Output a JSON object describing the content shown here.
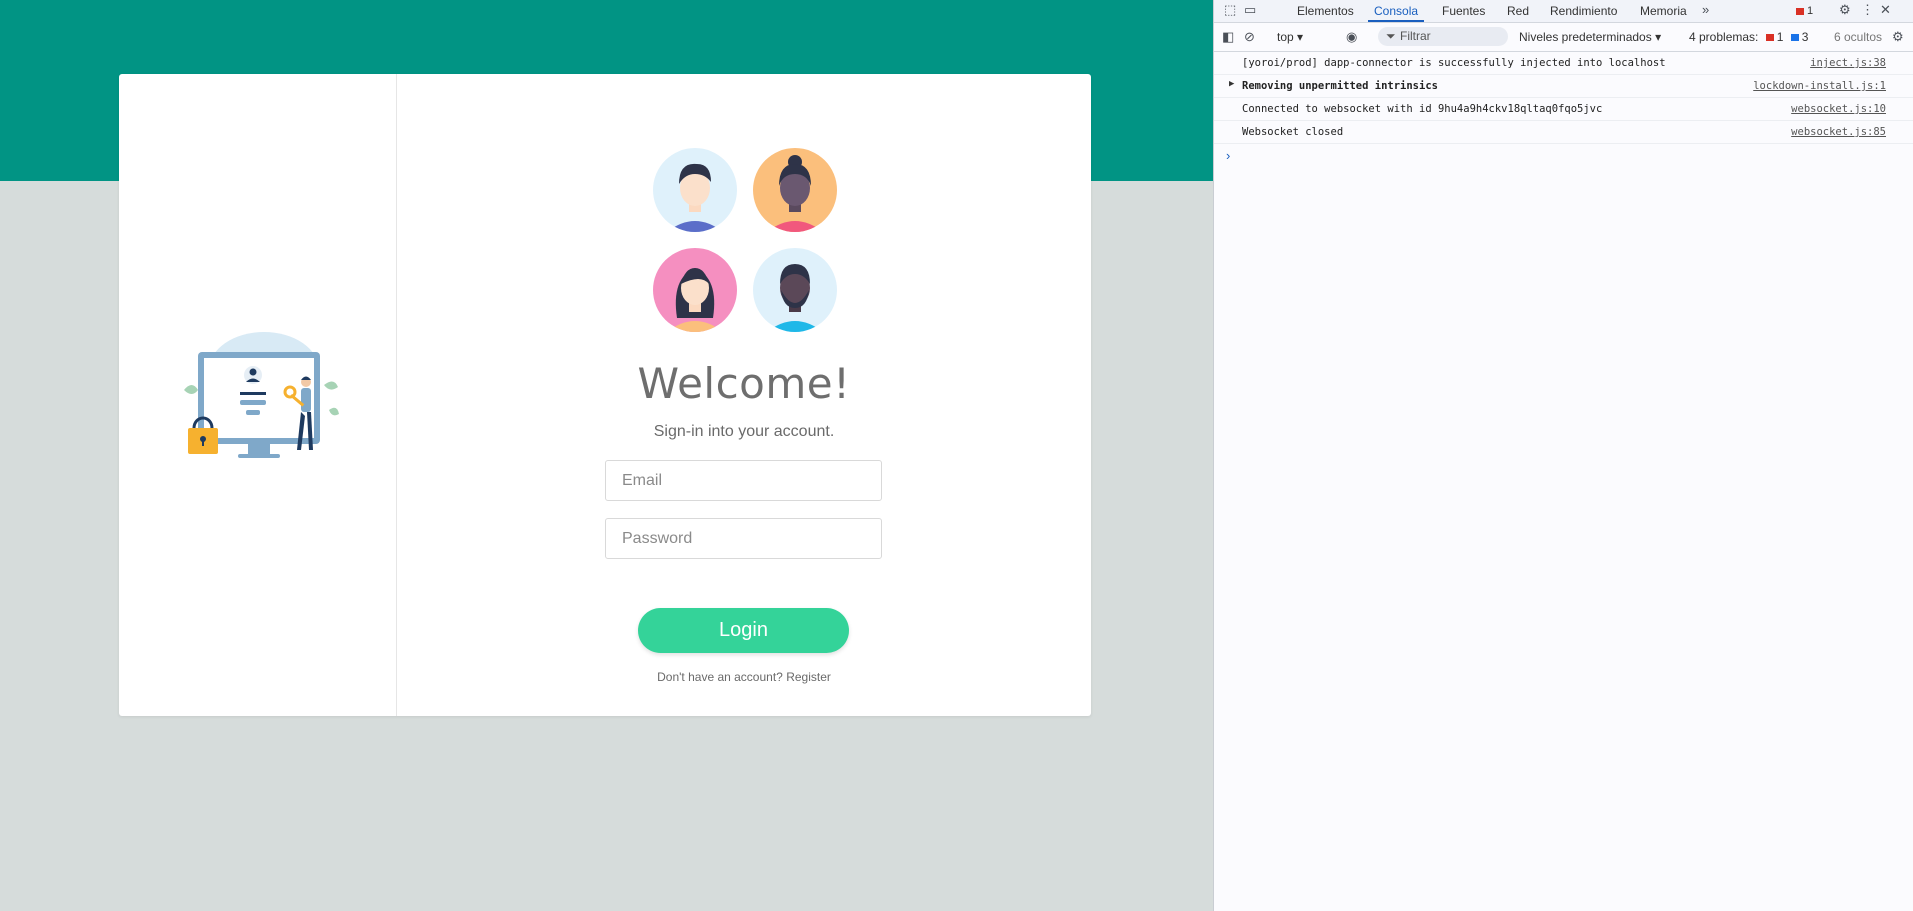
{
  "page": {
    "welcome": "Welcome!",
    "subtitle": "Sign-in into your account.",
    "email_placeholder": "Email",
    "password_placeholder": "Password",
    "login_label": "Login",
    "register_prompt": "Don't have an account?",
    "register_link": "Register",
    "colors": {
      "banner": "#019484",
      "background": "#d6dcdb",
      "button": "#34d399"
    }
  },
  "devtools": {
    "tabs": [
      "Elementos",
      "Consola",
      "Fuentes",
      "Red",
      "Rendimiento",
      "Memoria"
    ],
    "active_tab": "Consola",
    "error_count": "1",
    "context": "top",
    "filter_placeholder": "Filtrar",
    "levels": "Niveles predeterminados",
    "problems_label": "4 problemas:",
    "problems_errors": "1",
    "problems_info": "3",
    "hidden": "6 ocultos",
    "logs": [
      {
        "message": "[yoroi/prod] dapp-connector is successfully injected into localhost",
        "source": "inject.js:38"
      },
      {
        "message": "Removing unpermitted intrinsics",
        "source": "lockdown-install.js:1"
      },
      {
        "message": "Connected to websocket with id 9hu4a9h4ckv18qltaq0fqo5jvc",
        "source": "websocket.js:10"
      },
      {
        "message": "Websocket closed",
        "source": "websocket.js:85"
      }
    ]
  }
}
